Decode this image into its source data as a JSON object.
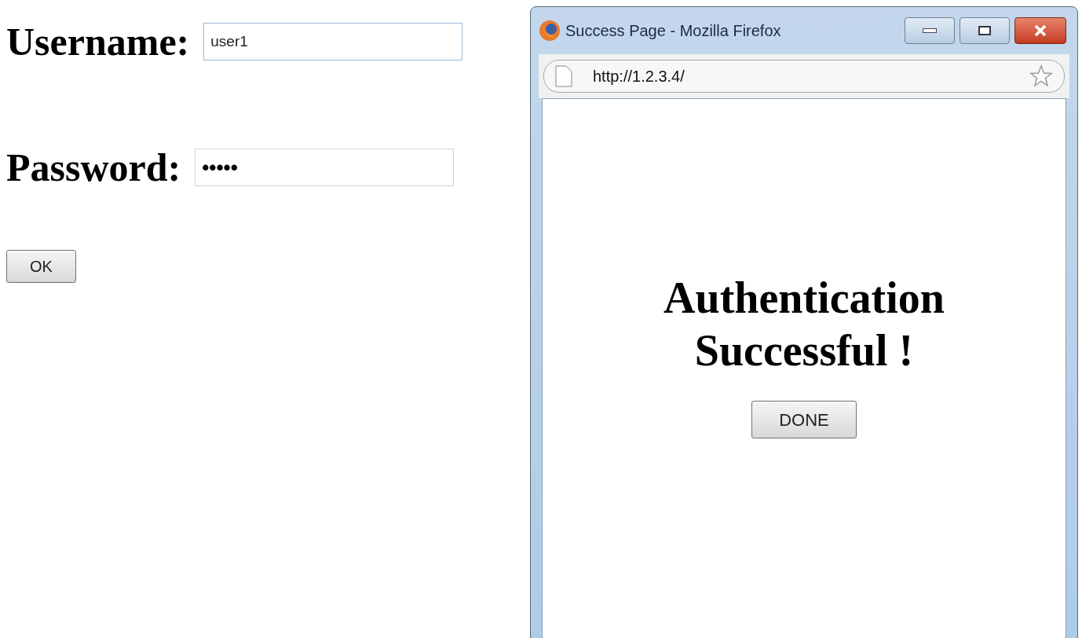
{
  "form": {
    "username": {
      "label": "Username:",
      "value": "user1"
    },
    "password": {
      "label": "Password:",
      "value": "•••••"
    },
    "ok_button": "OK"
  },
  "popup": {
    "title": "Success Page - Mozilla Firefox",
    "url": "http://1.2.3.4/",
    "heading": "Authentication Successful !",
    "done_button": "DONE"
  }
}
